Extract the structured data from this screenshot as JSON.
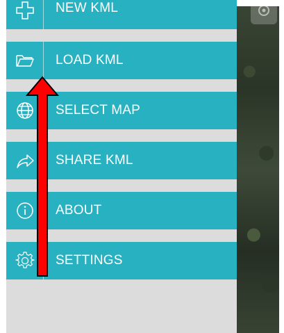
{
  "menu": {
    "items": [
      {
        "label": "NEW KML",
        "icon": "plus-outline-icon"
      },
      {
        "label": "LOAD KML",
        "icon": "folder-icon"
      },
      {
        "label": "SELECT MAP",
        "icon": "globe-icon"
      },
      {
        "label": "SHARE KML",
        "icon": "share-arrow-icon"
      },
      {
        "label": "ABOUT",
        "icon": "info-icon"
      },
      {
        "label": "SETTINGS",
        "icon": "gear-icon"
      }
    ]
  },
  "colors": {
    "menu_item_bg": "#28b1c1",
    "menu_panel_bg": "#dcdcdc",
    "annotation_arrow": "#ff0000"
  }
}
